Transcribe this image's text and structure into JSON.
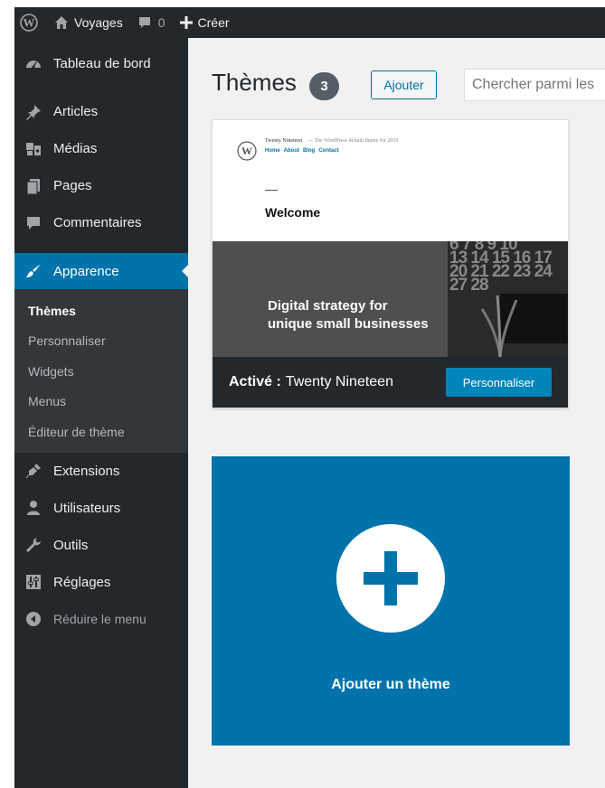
{
  "admin_bar": {
    "site_name": "Voyages",
    "comments_count": "0",
    "new_label": "Créer"
  },
  "sidebar": {
    "items_top": [
      {
        "label": "Tableau de bord",
        "icon": "dashboard-icon"
      },
      {
        "label": "Articles",
        "icon": "pin-icon"
      },
      {
        "label": "Médias",
        "icon": "media-icon"
      },
      {
        "label": "Pages",
        "icon": "pages-icon"
      },
      {
        "label": "Commentaires",
        "icon": "comment-icon"
      }
    ],
    "current": {
      "label": "Apparence",
      "icon": "brush-icon"
    },
    "submenu": [
      {
        "label": "Thèmes",
        "current": true
      },
      {
        "label": "Personnaliser"
      },
      {
        "label": "Widgets"
      },
      {
        "label": "Menus"
      },
      {
        "label": "Éditeur de thème"
      }
    ],
    "items_bottom": [
      {
        "label": "Extensions",
        "icon": "plugin-icon"
      },
      {
        "label": "Utilisateurs",
        "icon": "users-icon"
      },
      {
        "label": "Outils",
        "icon": "wrench-icon"
      },
      {
        "label": "Réglages",
        "icon": "settings-icon"
      }
    ],
    "collapse_label": "Réduire le menu"
  },
  "main": {
    "title": "Thèmes",
    "count": "3",
    "add_button": "Ajouter",
    "search_placeholder": "Chercher parmi les"
  },
  "theme_card": {
    "screenshot": {
      "site_title": "Twenty Nineteen",
      "tagline": "— The WordPress default theme for 2019",
      "nav": [
        "Home",
        "About",
        "Blog",
        "Contact"
      ],
      "welcome": "Welcome",
      "hero_line1": "Digital strategy for",
      "hero_line2": "unique small businesses",
      "calendar_rows": [
        "6  7  8  9  10",
        "13 14 15 16 17",
        "20 21 22 23 24",
        "27 28"
      ]
    },
    "active_label": "Activé :",
    "theme_name": "Twenty Nineteen",
    "customize_button": "Personnaliser"
  },
  "add_theme": {
    "label": "Ajouter un thème"
  },
  "colors": {
    "admin_dark": "#23282d",
    "submenu_dark": "#32373c",
    "accent": "#0073aa",
    "button_blue": "#0085ba"
  }
}
